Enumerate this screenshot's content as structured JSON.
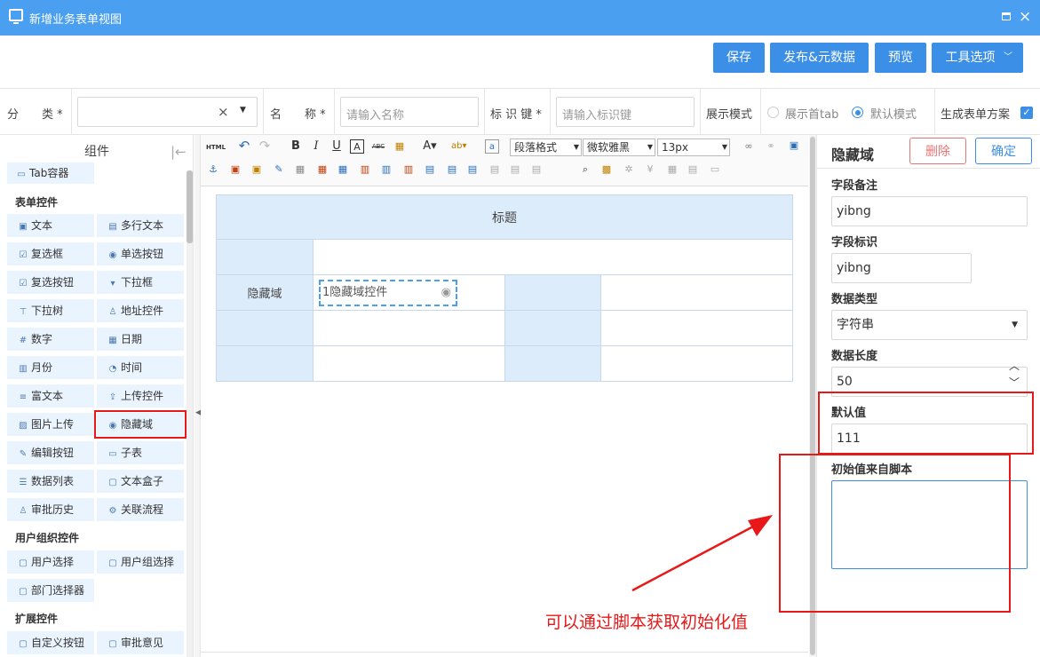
{
  "window": {
    "title": "新增业务表单视图",
    "icon": "monitor-icon"
  },
  "toolbar": {
    "save": "保存",
    "publish": "发布&元数据",
    "preview": "预览",
    "tools": "工具选项"
  },
  "form": {
    "category_label": "分　　类 *",
    "name_label": "名　　称 *",
    "name_placeholder": "请输入名称",
    "key_label": "标 识 键 *",
    "key_placeholder": "请输入标识键",
    "display_mode_label": "展示模式",
    "radio_first_tab": "展示首tab",
    "radio_default": "默认模式",
    "generate_label": "生成表单方案",
    "generate_checked": true
  },
  "left": {
    "header": "组件",
    "tab_container": "Tab容器",
    "sections": {
      "form_controls": "表单控件",
      "user_org": "用户组织控件",
      "ext": "扩展控件"
    },
    "items": [
      "文本",
      "多行文本",
      "复选框",
      "单选按钮",
      "复选按钮",
      "下拉框",
      "下拉树",
      "地址控件",
      "数字",
      "日期",
      "月份",
      "时间",
      "富文本",
      "上传控件",
      "图片上传",
      "隐藏域",
      "编辑按钮",
      "子表",
      "数据列表",
      "文本盒子",
      "审批历史",
      "关联流程"
    ],
    "org_items": [
      "用户选择",
      "用户组选择",
      "部门选择器"
    ],
    "ext_items": [
      "自定义按钮",
      "审批意见"
    ],
    "icons": [
      "text-icon",
      "textarea-icon",
      "checkbox-icon",
      "radio-icon",
      "checkbutton-icon",
      "select-icon",
      "tree-icon",
      "user-pin-icon",
      "number-icon",
      "calendar-icon",
      "month-icon",
      "clock-icon",
      "richtext-icon",
      "upload-icon",
      "image-icon",
      "eye-icon",
      "edit-icon",
      "table-icon",
      "list-icon",
      "textbox-icon",
      "history-icon",
      "flow-icon"
    ]
  },
  "editor": {
    "toolbar": {
      "html": "HTML",
      "para_format": "段落格式",
      "font_family": "微软雅黑",
      "font_size": "13px"
    },
    "table": {
      "title": "标题",
      "hidden_label": "隐藏域",
      "hidden_control": "1隐藏域控件"
    }
  },
  "right": {
    "title": "隐藏域",
    "delete_button": "删除",
    "confirm_button": "确定",
    "field_remark_label": "字段备注",
    "field_remark_value": "yibng",
    "field_key_label": "字段标识",
    "field_key_value": "yibng",
    "data_type_label": "数据类型",
    "data_type_value": "字符串",
    "data_length_label": "数据长度",
    "data_length_value": "50",
    "default_value_label": "默认值",
    "default_value": "111",
    "script_init_label": "初始值来自脚本",
    "script_init_value": ""
  },
  "annotation": {
    "text": "可以通过脚本获取初始化值",
    "color": "#e81818"
  },
  "colors": {
    "title_bar": "#4a9ff0",
    "primary": "#3c8fe6",
    "delete_border": "#e87575",
    "highlight_red": "#e81818"
  }
}
